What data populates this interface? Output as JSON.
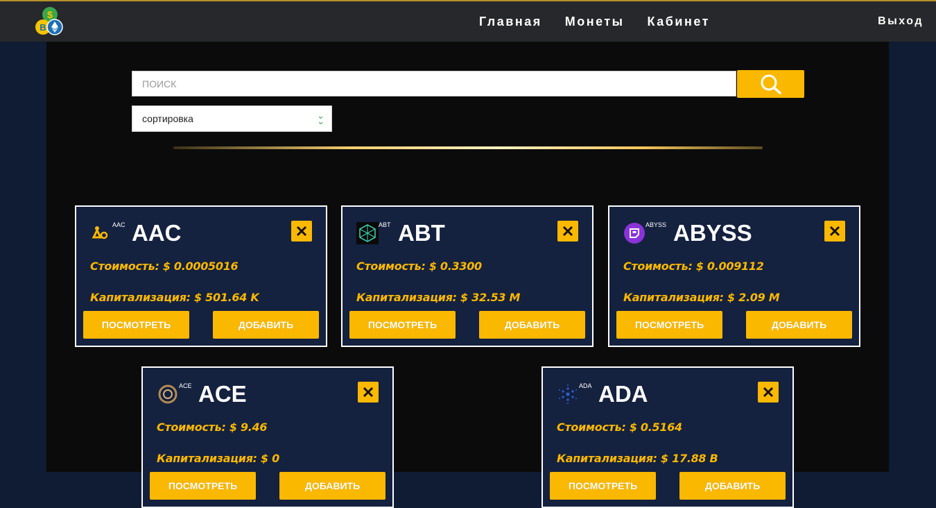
{
  "header": {
    "nav": [
      "Главная",
      "Монеты",
      "Кабинет"
    ],
    "logout": "Выход"
  },
  "search": {
    "placeholder": "ПОИСК",
    "value": ""
  },
  "sort": {
    "selected": "сортировка"
  },
  "colors": {
    "accent": "#fbb800",
    "card_bg": "#14213f",
    "page_bg": "#0b0b0b",
    "side_bg": "#0f1c33"
  },
  "cards": [
    {
      "ticker": "AAC",
      "name": "AAC",
      "price_label": "Стоимость: $ 0.0005016",
      "cap_label": "Капитализация: $ 501.64 K",
      "icon": "aac-logo-icon"
    },
    {
      "ticker": "ABT",
      "name": "ABT",
      "price_label": "Стоимость: $ 0.3300",
      "cap_label": "Капитализация: $ 32.53 M",
      "icon": "abt-logo-icon"
    },
    {
      "ticker": "ABYSS",
      "name": "ABYSS",
      "price_label": "Стоимость: $ 0.009112",
      "cap_label": "Капитализация: $ 2.09 M",
      "icon": "abyss-logo-icon"
    },
    {
      "ticker": "ACE",
      "name": "ACE",
      "price_label": "Стоимость: $ 9.46",
      "cap_label": "Капитализация: $ 0",
      "icon": "ace-logo-icon"
    },
    {
      "ticker": "ADA",
      "name": "ADA",
      "price_label": "Стоимость: $ 0.5164",
      "cap_label": "Капитализация: $ 17.88 B",
      "icon": "ada-logo-icon"
    }
  ],
  "card_buttons": {
    "view": "ПОСМОТРЕТЬ",
    "add": "ДОБАВИТЬ"
  }
}
